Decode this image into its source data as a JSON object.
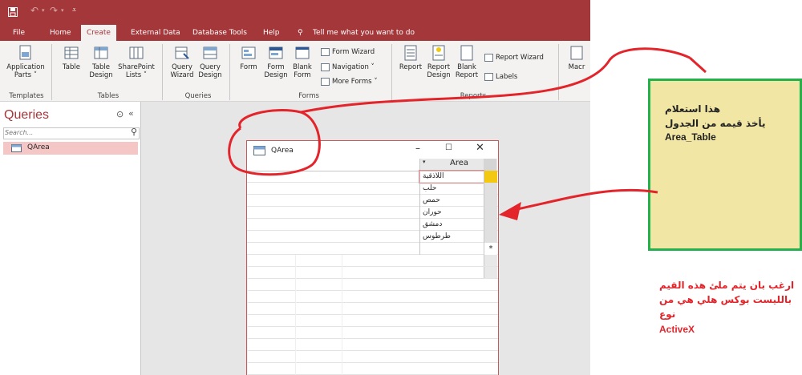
{
  "titlebar": {
    "save_icon": "save-icon",
    "undo_icon": "undo-icon",
    "redo_icon": "redo-icon",
    "customize_icon": "customize-icon",
    "bg": "#a4373a"
  },
  "tabs": [
    {
      "label": "File"
    },
    {
      "label": "Home"
    },
    {
      "label": "Create"
    },
    {
      "label": "External Data"
    },
    {
      "label": "Database Tools"
    },
    {
      "label": "Help"
    },
    {
      "label": "Tell me what you want to do"
    }
  ],
  "ribbon": {
    "templates": {
      "app_parts": "Application",
      "app_parts2": "Parts ˅",
      "group": "Templates"
    },
    "tables": {
      "table": "Table",
      "design": "Table",
      "design2": "Design",
      "sharepoint": "SharePoint",
      "sharepoint2": "Lists ˅",
      "group": "Tables"
    },
    "queries": {
      "wizard": "Query",
      "wizard2": "Wizard",
      "design": "Query",
      "design2": "Design",
      "group": "Queries"
    },
    "forms": {
      "form": "Form",
      "design": "Form",
      "design2": "Design",
      "blank": "Blank",
      "blank2": "Form",
      "form_wizard": "Form Wizard",
      "navigation": "Navigation ˅",
      "more_forms": "More Forms ˅",
      "group": "Forms"
    },
    "reports": {
      "report": "Report",
      "design": "Report",
      "design2": "Design",
      "blank": "Blank",
      "blank2": "Report",
      "report_wizard": "Report Wizard",
      "labels": "Labels",
      "group": "Reports"
    },
    "macro": {
      "label": "Macr"
    }
  },
  "nav": {
    "title": "Queries",
    "search_placeholder": "Search...",
    "item": "QArea"
  },
  "qwindow": {
    "title": "QArea",
    "column_header": "Area",
    "rows": [
      "اللاذقية",
      "حلب",
      "حمص",
      "حوران",
      "دمشق",
      "طرطوس"
    ],
    "new_row_marker": "*"
  },
  "annotations": {
    "note_line1": "هذا استعلام",
    "note_line2": "يأخذ قيمه من الجدول",
    "note_line3": "Area_Table",
    "red_line1": "ارغب بان يتم ملئ هذه القيم",
    "red_line2": "بالليست بوكس هلي هي من",
    "red_line3": "نوع",
    "red_line4": "ActiveX"
  }
}
